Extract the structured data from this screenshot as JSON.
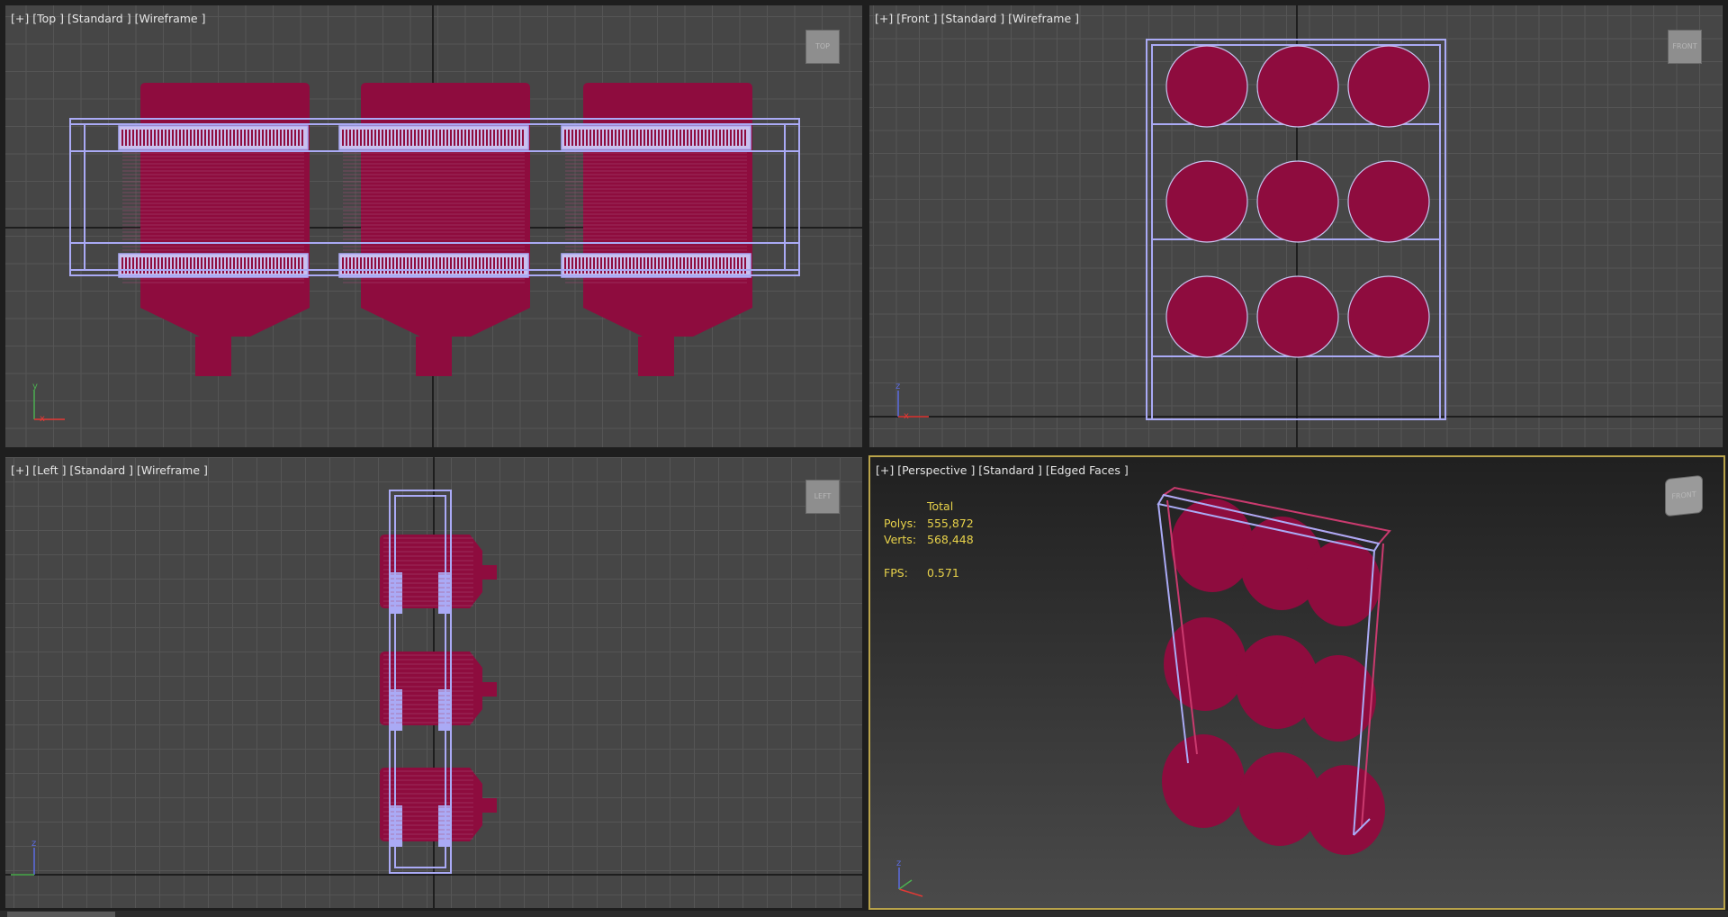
{
  "viewports": {
    "top": {
      "label": "[+] [Top ] [Standard ] [Wireframe ]",
      "cube": "TOP"
    },
    "front": {
      "label": "[+] [Front ] [Standard ] [Wireframe ]",
      "cube": "FRONT"
    },
    "left": {
      "label": "[+] [Left ] [Standard ] [Wireframe ]",
      "cube": "LEFT"
    },
    "persp": {
      "label": "[+] [Perspective ] [Standard ] [Edged Faces ]",
      "cube": "FRONT"
    }
  },
  "stats": {
    "header": "Total",
    "polys_label": "Polys:",
    "polys": "555,872",
    "verts_label": "Verts:",
    "verts": "568,448",
    "fps_label": "FPS:",
    "fps": "0.571"
  },
  "colors": {
    "object": "#8e0c3e",
    "frame": "#aaaaf5",
    "active_border": "#b9a34a",
    "stats_text": "#e8d24a"
  }
}
